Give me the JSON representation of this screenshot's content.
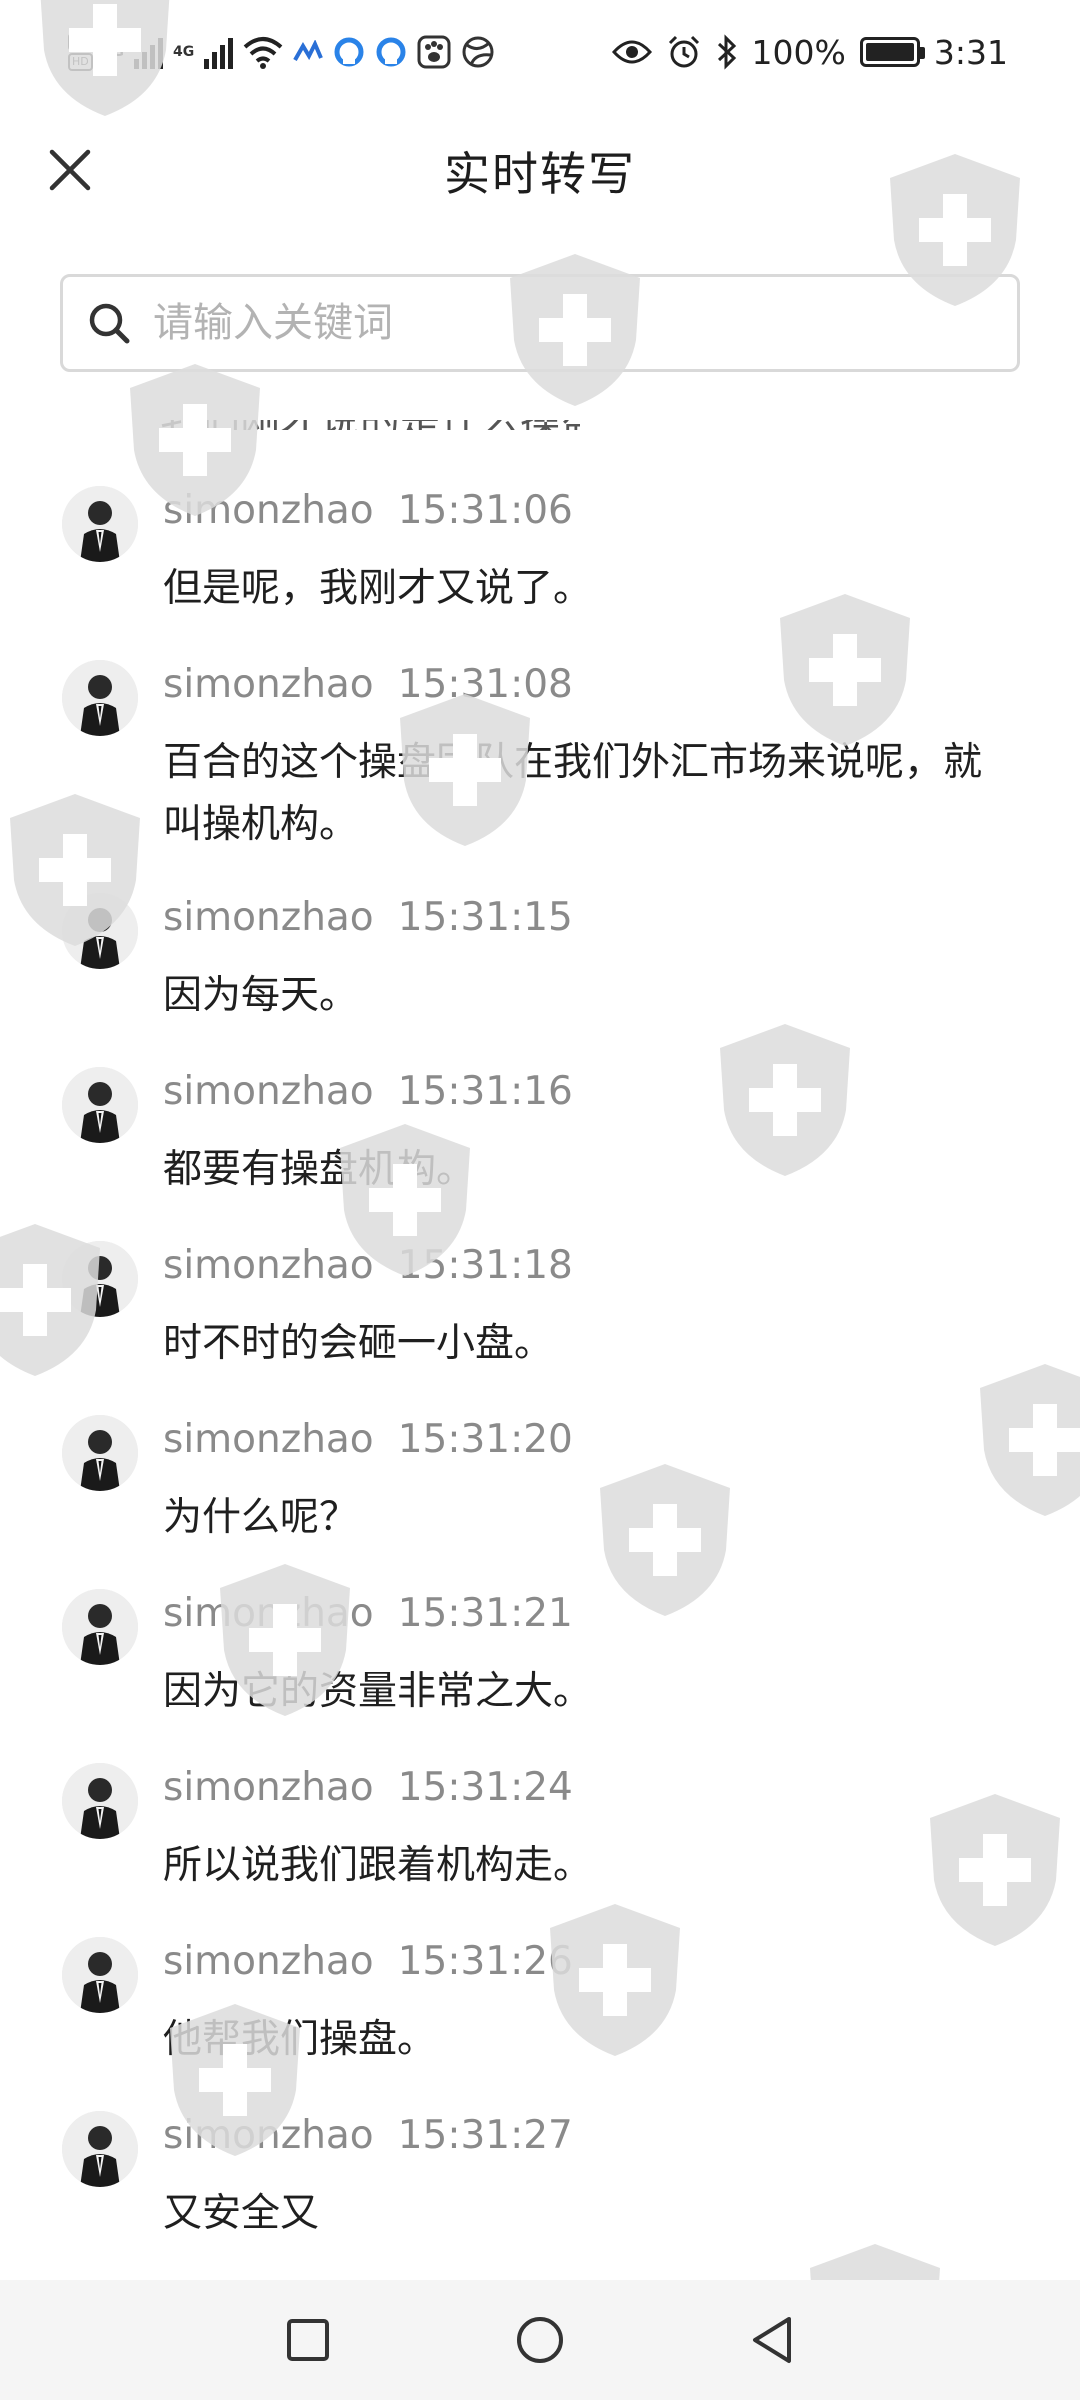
{
  "status_bar": {
    "hd1": "HD",
    "hd2": "HD",
    "net1": "4G",
    "net2": "4G",
    "battery": "100%",
    "time": "3:31"
  },
  "header": {
    "title": "实时转写",
    "close_icon": "close-icon"
  },
  "search": {
    "placeholder": "请输入关键词",
    "value": ""
  },
  "transcript": {
    "cut_text": "我们刚才说的是什么操盘",
    "entries": [
      {
        "user": "simonzhao",
        "time": "15:31:06",
        "text": "但是呢，我刚才又说了。"
      },
      {
        "user": "simonzhao",
        "time": "15:31:08",
        "text": "百合的这个操盘团队在我们外汇市场来说呢，就叫操机构。"
      },
      {
        "user": "simonzhao",
        "time": "15:31:15",
        "text": "因为每天。"
      },
      {
        "user": "simonzhao",
        "time": "15:31:16",
        "text": "都要有操盘机构。"
      },
      {
        "user": "simonzhao",
        "time": "15:31:18",
        "text": "时不时的会砸一小盘。"
      },
      {
        "user": "simonzhao",
        "time": "15:31:20",
        "text": "为什么呢？"
      },
      {
        "user": "simonzhao",
        "time": "15:31:21",
        "text": "因为它的资量非常之大。"
      },
      {
        "user": "simonzhao",
        "time": "15:31:24",
        "text": "所以说我们跟着机构走。"
      },
      {
        "user": "simonzhao",
        "time": "15:31:26",
        "text": "他帮我们操盘。"
      },
      {
        "user": "simonzhao",
        "time": "15:31:27",
        "text": "又安全又"
      }
    ]
  },
  "nav": {
    "recent": "square-icon",
    "home": "circle-icon",
    "back": "triangle-back-icon"
  },
  "colors": {
    "meta_text": "#8a8a8a",
    "body_text": "#1f1f1f",
    "watermark": "#dcdcdc"
  }
}
